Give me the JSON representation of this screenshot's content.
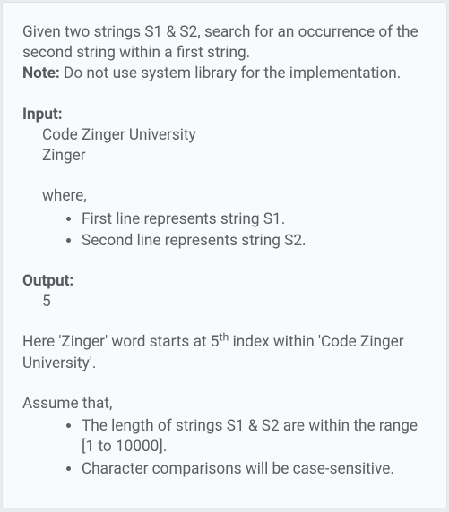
{
  "intro": {
    "line1": "Given two strings S1 & S2, search for an occurrence of the second string within a first string.",
    "noteLabel": "Note:",
    "noteText": " Do not use system library for the implementation."
  },
  "input": {
    "label": "Input:",
    "line1": "Code Zinger University",
    "line2": "Zinger",
    "whereLabel": "where,",
    "bullets": [
      "First line represents string S1.",
      "Second line represents string S2."
    ]
  },
  "output": {
    "label": "Output:",
    "value": "5"
  },
  "explain": {
    "pre": "Here 'Zinger' word starts at 5",
    "sup": "th",
    "post": " index within 'Code Zinger University'."
  },
  "assume": {
    "label": "Assume that,",
    "bullets": [
      "The length of strings S1 & S2 are within the range [1 to 10000].",
      "Character comparisons will be case-sensitive."
    ]
  }
}
